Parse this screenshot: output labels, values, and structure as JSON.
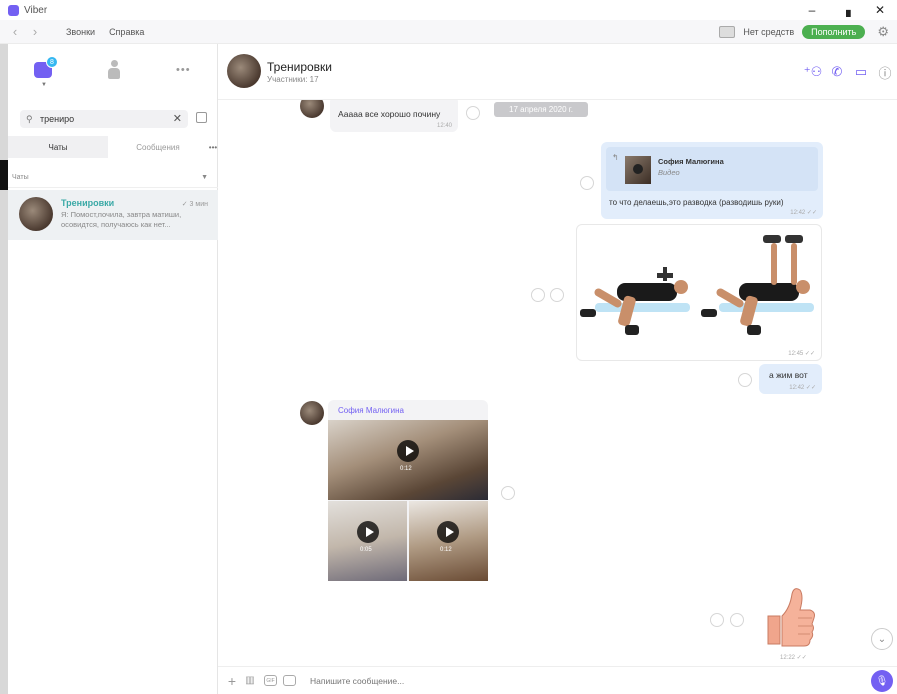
{
  "window": {
    "title": "Viber",
    "minimize": "–",
    "maximize": "▗",
    "close": "✕"
  },
  "menubar": {
    "back": "‹",
    "forward": "›",
    "items": [
      "Звонки",
      "Справка"
    ],
    "credit_label": "Нет средств",
    "topup_label": "Пополнить"
  },
  "sidebar": {
    "chats_badge": "8",
    "more": "•••",
    "search": {
      "value": "тренирo",
      "clear": "✕"
    },
    "tabs": [
      {
        "label": "Чаты",
        "active": true
      },
      {
        "label": "Сообщения",
        "active": false
      }
    ],
    "tabs_more": "•••",
    "section_label": "Чаты",
    "chats": [
      {
        "name": "Тренировки",
        "time": "✓ 3 мин",
        "preview": "Я: Помост,почила, завтра матиши, осовидтся, получаюсь как нет..."
      }
    ]
  },
  "chat": {
    "title": "Тренировки",
    "subtitle": "Участники: 17",
    "messages": {
      "date_pill": "17 апреля 2020 г.",
      "m1_text": "Ааааа все хорошо почину",
      "m1_time": "12:40",
      "m2_quote_name": "София Малюгина",
      "m2_quote_type": "Видео",
      "m2_text": "то что делаешь,это разводка (разводишь руки)",
      "m2_time": "12:42 ✓✓",
      "m3_time": "12:45 ✓✓",
      "m4_text": "а жим вот",
      "m4_time": "12:42 ✓✓",
      "m5_sender": "София Малюгина",
      "m5_durations": [
        "0:12",
        "0:05",
        "0:12"
      ],
      "m6_time": "12:22 ✓✓"
    },
    "scroll_down": "⌄"
  },
  "compose": {
    "placeholder": "Напишите сообщение..."
  },
  "colors": {
    "accent": "#7360f2",
    "teal": "#3aa9a6",
    "green": "#4caf50",
    "bubble_out": "#e2edfb"
  }
}
